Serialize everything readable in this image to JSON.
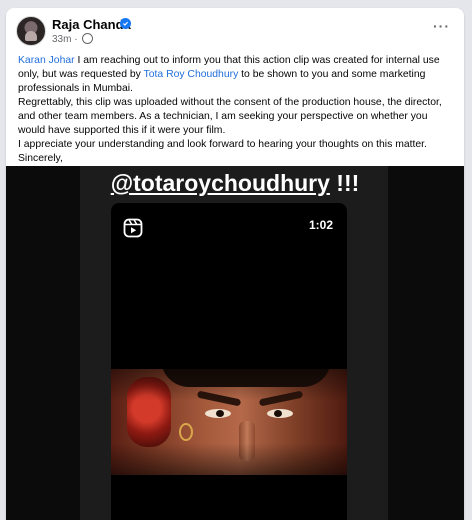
{
  "post": {
    "author": "Raja Chanda",
    "time": "33m",
    "time_separator": "·",
    "more_label": "···",
    "paragraphs": {
      "p1": {
        "mention1": "Karan Johar",
        "text1": " I am reaching out to inform you that this action clip was created for internal use only, but was requested by ",
        "mention2": "Tota Roy Choudhury",
        "text2": " to be shown to you and some marketing professionals in Mumbai."
      },
      "p2": "Regrettably, this clip was uploaded without the consent of the production house, the director, and other team members. As a technician, I am seeking your perspective on whether you would have supported this if it were your film.",
      "p3": "I appreciate your understanding and look forward to hearing your thoughts on this matter.",
      "p4": "Sincerely,"
    }
  },
  "media": {
    "handle": "@totaroychoudhury",
    "exclaim": " !!!",
    "duration": "1:02",
    "reel_icon": "reels-icon"
  },
  "colors": {
    "link": "#216fdb",
    "verified": "#1877f2",
    "background": "#e4e6eb"
  }
}
